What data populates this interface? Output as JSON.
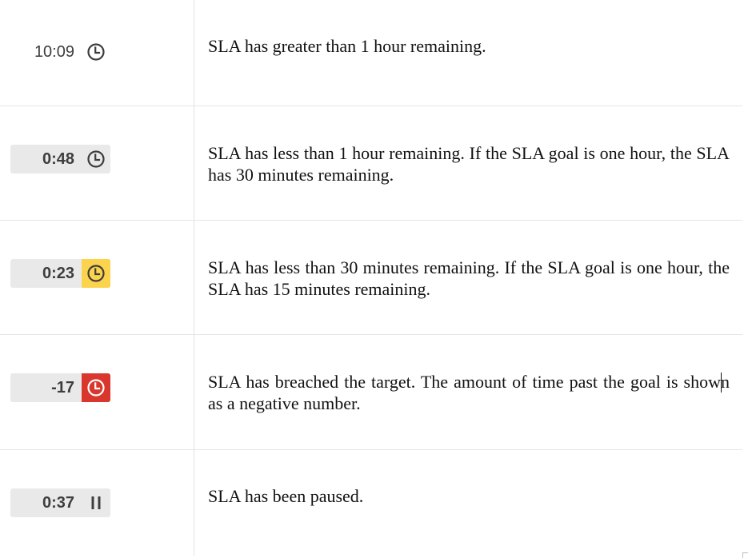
{
  "rows": [
    {
      "badge": {
        "time": "10:09",
        "style": "plain",
        "icon": "clock-icon",
        "icon_bg": "none"
      },
      "description": "SLA has greater than 1 hour remaining."
    },
    {
      "badge": {
        "time": "0:48",
        "style": "gray",
        "icon": "clock-icon",
        "icon_bg": "none"
      },
      "description": "SLA has less than 1 hour remaining. If the SLA goal is one hour, the SLA has 30 minutes remaining."
    },
    {
      "badge": {
        "time": "0:23",
        "style": "gray",
        "icon": "clock-icon",
        "icon_bg": "#fcd34d"
      },
      "description": "SLA has less than 30 minutes remaining. If the SLA goal is one hour, the SLA has 15 minutes remaining."
    },
    {
      "badge": {
        "time": "-17",
        "style": "gray",
        "icon": "clock-icon",
        "icon_bg": "#d9372e"
      },
      "description": "SLA has breached the target. The amount of time past the goal is shown as a negative number."
    },
    {
      "badge": {
        "time": "0:37",
        "style": "gray",
        "icon": "pause-icon",
        "icon_bg": "none"
      },
      "description": "SLA has been paused."
    }
  ],
  "colors": {
    "badge_gray": "#e9e9e9",
    "warning_yellow": "#fcd34d",
    "breach_red": "#d9372e",
    "icon_dark": "#3d3d3d",
    "icon_light": "#ffffff"
  }
}
